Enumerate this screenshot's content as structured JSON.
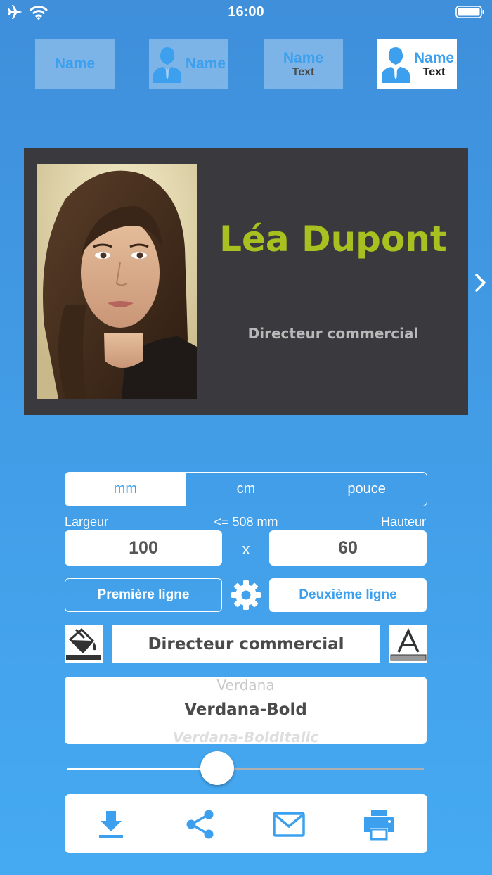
{
  "status": {
    "time": "16:00"
  },
  "templates": [
    {
      "name": "Name",
      "text": ""
    },
    {
      "name": "Name",
      "text": ""
    },
    {
      "name": "Name",
      "text": "Text"
    },
    {
      "name": "Name",
      "text": "Text"
    }
  ],
  "card": {
    "name": "Léa Dupont",
    "title": "Directeur commercial",
    "name_color": "#a8c020",
    "title_color": "#b8b8b8",
    "background": "#3a3a3e"
  },
  "units": {
    "options": [
      "mm",
      "cm",
      "pouce"
    ],
    "selected": "mm"
  },
  "dimensions": {
    "width_label": "Largeur",
    "max_label": "<= 508 mm",
    "height_label": "Hauteur",
    "width": "100",
    "separator": "x",
    "height": "60"
  },
  "lines": {
    "first": "Première ligne",
    "second": "Deuxième ligne",
    "selected": "first"
  },
  "text_field": {
    "value": "Directeur commercial"
  },
  "font_picker": {
    "previous": "Verdana",
    "current": "Verdana-Bold",
    "next": "Verdana-BoldItalic"
  },
  "font_size_slider": {
    "value": 0.42
  },
  "colors": {
    "accent": "#3ca0ee",
    "background_top": "#3f8fdb",
    "background_bottom": "#45aaf2"
  },
  "icons": [
    "airplane-icon",
    "wifi-icon",
    "battery-icon",
    "person-icon",
    "chevron-right-icon",
    "gear-icon",
    "paint-bucket-icon",
    "text-color-icon",
    "download-icon",
    "share-icon",
    "mail-icon",
    "printer-icon"
  ]
}
